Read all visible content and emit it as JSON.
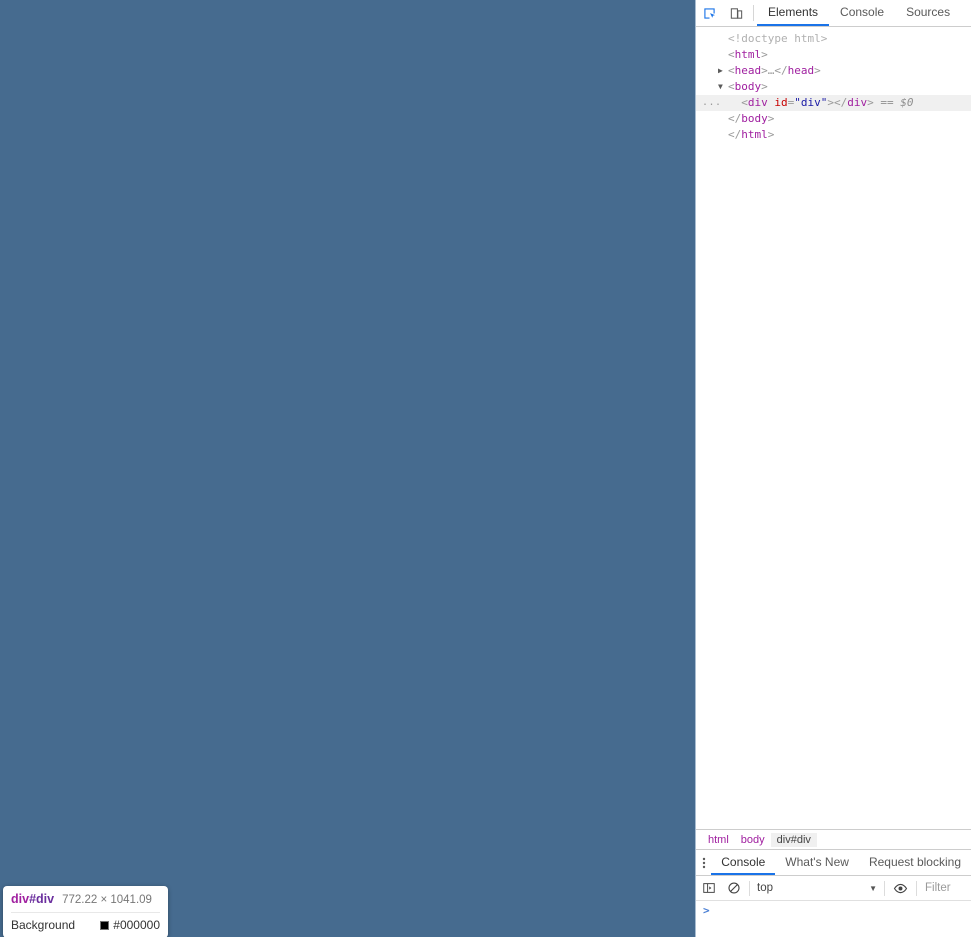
{
  "viewport": {
    "overlay_color": "#466b8f",
    "highlight_tooltip": {
      "tag_name": "div",
      "id_part": "#div",
      "dimensions": "772.22 × 1041.09",
      "property_label": "Background",
      "property_value": "#000000",
      "swatch_color": "#000000"
    }
  },
  "devtools": {
    "toolbar": {
      "inspect_icon": "inspect-element-icon",
      "device_icon": "device-toolbar-icon",
      "tabs": [
        {
          "label": "Elements",
          "active": true
        },
        {
          "label": "Console",
          "active": false
        },
        {
          "label": "Sources",
          "active": false
        }
      ]
    },
    "dom_tree": {
      "rows": [
        {
          "kind": "doctype",
          "text": "<!doctype html>"
        },
        {
          "kind": "open",
          "tag": "html"
        },
        {
          "kind": "collapsed",
          "tag": "head",
          "arrow": "▶"
        },
        {
          "kind": "open_expanded",
          "tag": "body",
          "arrow": "▼"
        },
        {
          "kind": "selected_div",
          "tag": "div",
          "attr": "id",
          "attr_value": "\"div\"",
          "suffix": "== $0",
          "badge": "..."
        },
        {
          "kind": "close",
          "tag": "body"
        },
        {
          "kind": "close",
          "tag": "html"
        }
      ]
    },
    "breadcrumb": {
      "items": [
        {
          "label": "html",
          "selected": false
        },
        {
          "label": "body",
          "selected": false
        },
        {
          "label": "div#div",
          "selected": true
        }
      ]
    },
    "drawer": {
      "menu_icon": "kebab-menu-icon",
      "tabs": [
        {
          "label": "Console",
          "active": true
        },
        {
          "label": "What's New",
          "active": false
        },
        {
          "label": "Request blocking",
          "active": false
        }
      ],
      "console_toolbar": {
        "sidebar_icon": "console-sidebar-icon",
        "clear_icon": "clear-console-icon",
        "context_value": "top",
        "context_caret": "▼",
        "eye_icon": "live-expression-eye-icon",
        "filter_placeholder": "Filter"
      },
      "prompt_caret": ">"
    }
  },
  "colors": {
    "accent": "#1a73e8",
    "overlay": "#466b8f",
    "selected_row": "#f0f0f0",
    "tag_purple": "#a020a0"
  }
}
